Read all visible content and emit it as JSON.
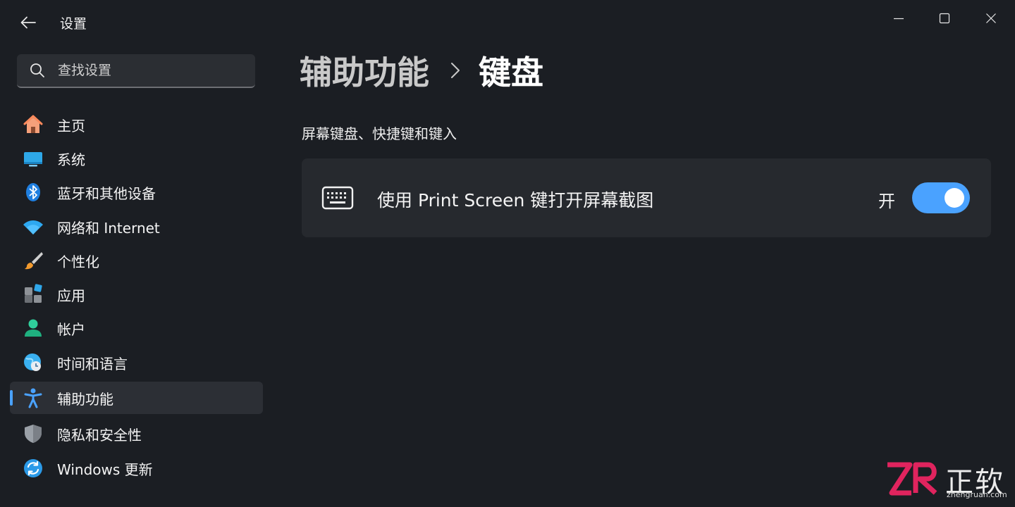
{
  "window": {
    "title": "设置",
    "controls": [
      "minimize-icon",
      "maximize-icon",
      "close-icon"
    ]
  },
  "search": {
    "placeholder": "查找设置"
  },
  "sidebar": {
    "items": [
      {
        "label": "主页",
        "icon": "home-icon"
      },
      {
        "label": "系统",
        "icon": "display-icon"
      },
      {
        "label": "蓝牙和其他设备",
        "icon": "bluetooth-icon"
      },
      {
        "label": "网络和 Internet",
        "icon": "wifi-icon"
      },
      {
        "label": "个性化",
        "icon": "brush-icon"
      },
      {
        "label": "应用",
        "icon": "apps-icon"
      },
      {
        "label": "帐户",
        "icon": "account-icon"
      },
      {
        "label": "时间和语言",
        "icon": "globe-clock-icon"
      },
      {
        "label": "辅助功能",
        "icon": "accessibility-icon",
        "active": true
      },
      {
        "label": "隐私和安全性",
        "icon": "shield-icon"
      },
      {
        "label": "Windows 更新",
        "icon": "update-icon"
      }
    ]
  },
  "main": {
    "breadcrumb": {
      "parent": "辅助功能",
      "current": "键盘"
    },
    "section_title": "屏幕键盘、快捷键和键入",
    "settings": [
      {
        "icon": "keyboard-icon",
        "label": "使用 Print Screen 键打开屏幕截图",
        "state_label": "开",
        "enabled": true
      }
    ]
  },
  "watermark": {
    "logo_text": "ZR",
    "text": "正软",
    "domain": "zhengruan.com"
  },
  "colors": {
    "accent": "#4aa2ff",
    "background": "#1b1e23",
    "card": "#26292e",
    "selected": "#2c2f35"
  }
}
